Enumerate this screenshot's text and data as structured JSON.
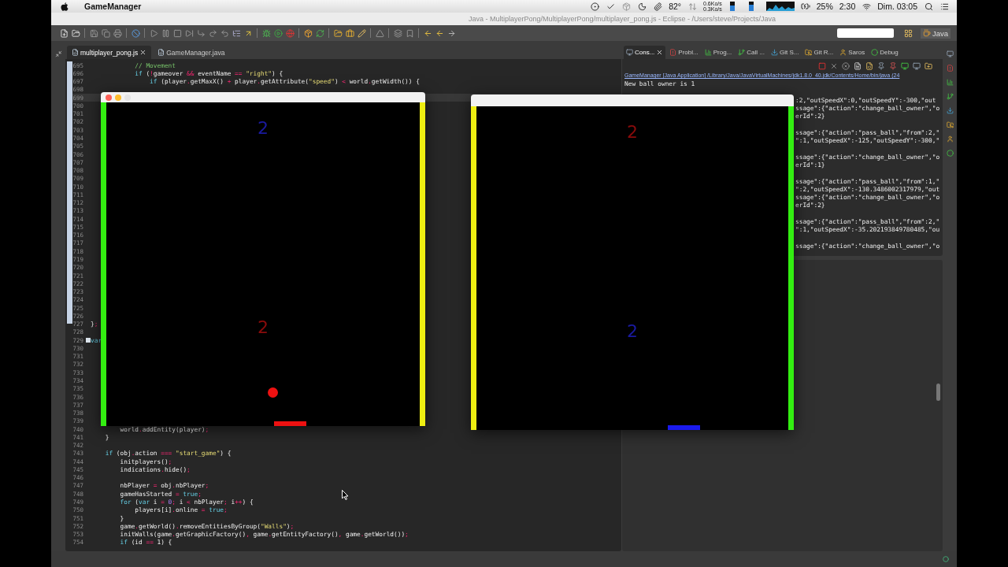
{
  "menu_bar": {
    "app_name": "GameManager",
    "temperature": "82°",
    "net_down": "0.6Ko/s",
    "net_up": "0.3Ko/s",
    "battery": "25%",
    "battery_time": "2:30",
    "clock": "Dim. 03:05"
  },
  "window": {
    "title": "Java - MultiplayerPong/MultiplayerPong/multiplayer_pong.js - Eclipse - /Users/steve/Projects/Java"
  },
  "toolbar": {
    "perspective": "Java"
  },
  "editor": {
    "tabs": [
      {
        "label": "multiplayer_pong.js",
        "selected": true
      },
      {
        "label": "GameManager.java",
        "selected": false
      }
    ],
    "lines": [
      {
        "number": "695",
        "current": false,
        "tokens": [
          {
            "text": "            // Movement",
            "kind": "comment"
          }
        ]
      },
      {
        "number": "696",
        "current": false,
        "tokens": [
          {
            "text": "            if",
            "kind": "keyword"
          },
          {
            "text": " (",
            "kind": "plain"
          },
          {
            "text": "!",
            "kind": "operator"
          },
          {
            "text": "gameover ",
            "kind": "plain"
          },
          {
            "text": "&&",
            "kind": "operator"
          },
          {
            "text": " eventName ",
            "kind": "plain"
          },
          {
            "text": "==",
            "kind": "operator"
          },
          {
            "text": " \"right\"",
            "kind": "string"
          },
          {
            "text": ") {",
            "kind": "plain"
          }
        ]
      },
      {
        "number": "697",
        "current": false,
        "tokens": [
          {
            "text": "                if",
            "kind": "keyword"
          },
          {
            "text": " (player",
            "kind": "plain"
          },
          {
            "text": ".",
            "kind": "operator"
          },
          {
            "text": "getMaxX() ",
            "kind": "plain"
          },
          {
            "text": "+",
            "kind": "operator"
          },
          {
            "text": " player",
            "kind": "plain"
          },
          {
            "text": ".",
            "kind": "operator"
          },
          {
            "text": "getAttribute(",
            "kind": "plain"
          },
          {
            "text": "\"speed\"",
            "kind": "string"
          },
          {
            "text": ") ",
            "kind": "plain"
          },
          {
            "text": "<",
            "kind": "operator"
          },
          {
            "text": " world",
            "kind": "plain"
          },
          {
            "text": ".",
            "kind": "operator"
          },
          {
            "text": "getWidth()) {",
            "kind": "plain"
          }
        ]
      },
      {
        "number": "698",
        "current": false
      },
      {
        "number": "699",
        "current": true
      },
      {
        "number": "700",
        "current": false
      },
      {
        "number": "701",
        "current": false
      },
      {
        "number": "702",
        "current": false
      },
      {
        "number": "703",
        "current": false
      },
      {
        "number": "704",
        "current": false
      },
      {
        "number": "705",
        "current": false
      },
      {
        "number": "706",
        "current": false
      },
      {
        "number": "707",
        "current": false
      },
      {
        "number": "708",
        "current": false
      },
      {
        "number": "709",
        "current": false
      },
      {
        "number": "710",
        "current": false
      },
      {
        "number": "711",
        "current": false
      },
      {
        "number": "712",
        "current": false
      },
      {
        "number": "713",
        "current": false
      },
      {
        "number": "714",
        "current": false
      },
      {
        "number": "715",
        "current": false
      },
      {
        "number": "716",
        "current": false
      },
      {
        "number": "717",
        "current": false
      },
      {
        "number": "718",
        "current": false
      },
      {
        "number": "719",
        "current": false
      },
      {
        "number": "720",
        "current": false
      },
      {
        "number": "721",
        "current": false
      },
      {
        "number": "722",
        "current": false
      },
      {
        "number": "723",
        "current": false
      },
      {
        "number": "724",
        "current": false
      },
      {
        "number": "725",
        "current": false
      },
      {
        "number": "726",
        "current": false
      },
      {
        "number": "727",
        "current": false,
        "tokens": [
          {
            "text": "}",
            "kind": "plain"
          },
          {
            "text": ";",
            "kind": "operator"
          }
        ]
      },
      {
        "number": "728",
        "current": false
      },
      {
        "number": "729",
        "current": false,
        "fold_marker": true,
        "tokens": [
          {
            "text": "var",
            "kind": "keyword"
          }
        ]
      },
      {
        "number": "730",
        "current": false
      },
      {
        "number": "731",
        "current": false
      },
      {
        "number": "732",
        "current": false
      },
      {
        "number": "733",
        "current": false
      },
      {
        "number": "734",
        "current": false
      },
      {
        "number": "735",
        "current": false
      },
      {
        "number": "736",
        "current": false
      },
      {
        "number": "737",
        "current": false
      },
      {
        "number": "738",
        "current": false
      },
      {
        "number": "739",
        "current": false
      },
      {
        "number": "740",
        "current": false,
        "tokens": [
          {
            "text": "        world",
            "kind": "plain"
          },
          {
            "text": ".",
            "kind": "operator"
          },
          {
            "text": "addEntity(player)",
            "kind": "plain"
          },
          {
            "text": ";",
            "kind": "operator"
          }
        ]
      },
      {
        "number": "741",
        "current": false,
        "tokens": [
          {
            "text": "    }",
            "kind": "plain"
          }
        ]
      },
      {
        "number": "742",
        "current": false
      },
      {
        "number": "743",
        "current": false,
        "tokens": [
          {
            "text": "    if",
            "kind": "keyword"
          },
          {
            "text": " (obj",
            "kind": "plain"
          },
          {
            "text": ".",
            "kind": "operator"
          },
          {
            "text": "action ",
            "kind": "plain"
          },
          {
            "text": "===",
            "kind": "operator"
          },
          {
            "text": " \"start_game\"",
            "kind": "string"
          },
          {
            "text": ") {",
            "kind": "plain"
          }
        ]
      },
      {
        "number": "744",
        "current": false,
        "tokens": [
          {
            "text": "        initplayers()",
            "kind": "plain"
          },
          {
            "text": ";",
            "kind": "operator"
          }
        ]
      },
      {
        "number": "745",
        "current": false,
        "tokens": [
          {
            "text": "        indications",
            "kind": "plain"
          },
          {
            "text": ".",
            "kind": "operator"
          },
          {
            "text": "hide()",
            "kind": "plain"
          },
          {
            "text": ";",
            "kind": "operator"
          }
        ]
      },
      {
        "number": "746",
        "current": false
      },
      {
        "number": "747",
        "current": false,
        "tokens": [
          {
            "text": "        nbPlayer ",
            "kind": "plain"
          },
          {
            "text": "=",
            "kind": "operator"
          },
          {
            "text": " obj",
            "kind": "plain"
          },
          {
            "text": ".",
            "kind": "operator"
          },
          {
            "text": "nbPlayer",
            "kind": "plain"
          },
          {
            "text": ";",
            "kind": "operator"
          }
        ]
      },
      {
        "number": "748",
        "current": false,
        "tokens": [
          {
            "text": "        gameHasStarted ",
            "kind": "plain"
          },
          {
            "text": "=",
            "kind": "operator"
          },
          {
            "text": " true",
            "kind": "keyword"
          },
          {
            "text": ";",
            "kind": "operator"
          }
        ]
      },
      {
        "number": "749",
        "current": false,
        "tokens": [
          {
            "text": "        for",
            "kind": "keyword"
          },
          {
            "text": " (",
            "kind": "plain"
          },
          {
            "text": "var",
            "kind": "keyword"
          },
          {
            "text": " i ",
            "kind": "plain"
          },
          {
            "text": "=",
            "kind": "operator"
          },
          {
            "text": " 0",
            "kind": "number"
          },
          {
            "text": ";",
            "kind": "operator"
          },
          {
            "text": " i ",
            "kind": "plain"
          },
          {
            "text": "<",
            "kind": "operator"
          },
          {
            "text": " nbPlayer",
            "kind": "plain"
          },
          {
            "text": ";",
            "kind": "operator"
          },
          {
            "text": " i",
            "kind": "plain"
          },
          {
            "text": "++",
            "kind": "operator"
          },
          {
            "text": ") {",
            "kind": "plain"
          }
        ]
      },
      {
        "number": "750",
        "current": false,
        "tokens": [
          {
            "text": "            players[i]",
            "kind": "plain"
          },
          {
            "text": ".",
            "kind": "operator"
          },
          {
            "text": "online ",
            "kind": "plain"
          },
          {
            "text": "=",
            "kind": "operator"
          },
          {
            "text": " true",
            "kind": "keyword"
          },
          {
            "text": ";",
            "kind": "operator"
          }
        ]
      },
      {
        "number": "751",
        "current": false,
        "tokens": [
          {
            "text": "        }",
            "kind": "plain"
          }
        ]
      },
      {
        "number": "752",
        "current": false,
        "tokens": [
          {
            "text": "        game",
            "kind": "plain"
          },
          {
            "text": ".",
            "kind": "operator"
          },
          {
            "text": "getWorld()",
            "kind": "plain"
          },
          {
            "text": ".",
            "kind": "operator"
          },
          {
            "text": "removeEntitiesByGroup(",
            "kind": "plain"
          },
          {
            "text": "\"Walls\"",
            "kind": "string"
          },
          {
            "text": ")",
            "kind": "plain"
          },
          {
            "text": ";",
            "kind": "operator"
          }
        ]
      },
      {
        "number": "753",
        "current": false,
        "tokens": [
          {
            "text": "        initWalls(game",
            "kind": "plain"
          },
          {
            "text": ".",
            "kind": "operator"
          },
          {
            "text": "getGraphicFactory()",
            "kind": "plain"
          },
          {
            "text": ",",
            "kind": "operator"
          },
          {
            "text": " game",
            "kind": "plain"
          },
          {
            "text": ".",
            "kind": "operator"
          },
          {
            "text": "getEntityFactory()",
            "kind": "plain"
          },
          {
            "text": ",",
            "kind": "operator"
          },
          {
            "text": " game",
            "kind": "plain"
          },
          {
            "text": ".",
            "kind": "operator"
          },
          {
            "text": "getWorld())",
            "kind": "plain"
          },
          {
            "text": ";",
            "kind": "operator"
          }
        ]
      },
      {
        "number": "754",
        "current": false,
        "tokens": [
          {
            "text": "        if",
            "kind": "keyword"
          },
          {
            "text": " (id ",
            "kind": "plain"
          },
          {
            "text": "==",
            "kind": "operator"
          },
          {
            "text": " 1) {",
            "kind": "plain"
          }
        ]
      }
    ]
  },
  "console": {
    "tabs": [
      {
        "label": "Cons...",
        "selected": true
      },
      {
        "label": "Probl...",
        "selected": false
      },
      {
        "label": "Prog...",
        "selected": false
      },
      {
        "label": "Call ...",
        "selected": false
      },
      {
        "label": "Git S...",
        "selected": false
      },
      {
        "label": "Git R...",
        "selected": false
      },
      {
        "label": "Saros",
        "selected": false
      },
      {
        "label": "Debug",
        "selected": false
      }
    ],
    "header": "GameManager [Java Application] /Library/Java/JavaVirtualMachines/jdk1.8.0_40.jdk/Contents/Home/bin/java (24",
    "first_line": "New ball owner is 1",
    "fragment_blocks": [
      [
        ":2,\"outSpeedX\":0,\"outSpeedY\":-300,\"out",
        "ssage\":{\"action\":\"change_ball_owner\",\"o",
        "erId\":2}"
      ],
      [
        "ssage\":{\"action\":\"pass_ball\",\"from\":2,\"",
        "\":1,\"outSpeedX\":-125,\"outSpeedY\":-300,\""
      ],
      [
        "ssage\":{\"action\":\"change_ball_owner\",\"o",
        "erId\":1}"
      ],
      [
        "ssage\":{\"action\":\"pass_ball\",\"from\":1,\"",
        "\":2,\"outSpeedX\":-130.3486002317979,\"out",
        "ssage\":{\"action\":\"change_ball_owner\",\"o",
        "erId\":2}"
      ],
      [
        "ssage\":{\"action\":\"pass_ball\",\"from\":2,\"",
        "\":1,\"outSpeedX\":-35.202193849780485,\"ou"
      ],
      [
        "ssage\":{\"action\":\"change_ball_owner\",\"o"
      ]
    ]
  },
  "game_windows": [
    {
      "traffic_lights": true,
      "walls": [
        {
          "color": "#33ee11"
        },
        {
          "color": "#eeee11"
        }
      ],
      "scores": [
        {
          "text": "2",
          "color": "#1a1aa0"
        },
        {
          "text": "2",
          "color": "#8a0b0b"
        }
      ],
      "ball": true,
      "paddle": {
        "color": "#ee1111"
      }
    },
    {
      "traffic_lights": false,
      "walls": [
        {
          "color": "#eeee11"
        },
        {
          "color": "#33ee11"
        }
      ],
      "scores": [
        {
          "text": "2",
          "color": "#8a0b0b"
        },
        {
          "text": "2",
          "color": "#1a1aa0"
        }
      ],
      "ball": false,
      "paddle": {
        "color": "#1a1aee"
      }
    }
  ]
}
